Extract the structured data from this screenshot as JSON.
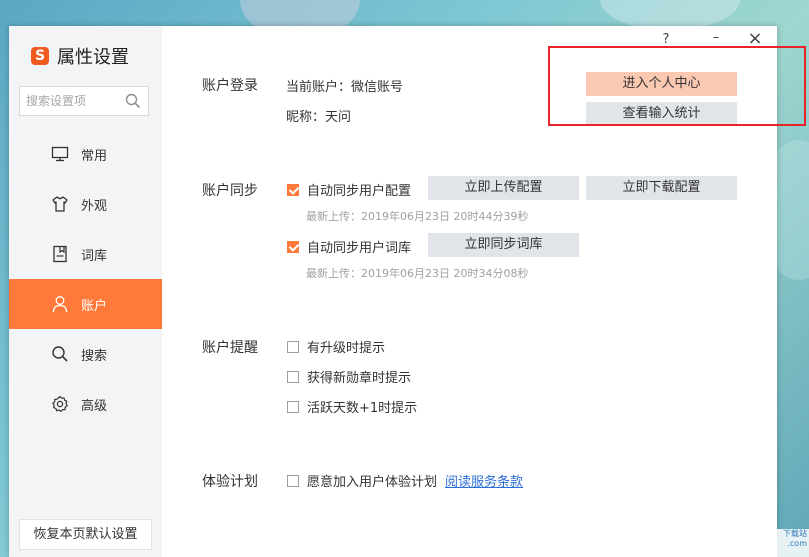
{
  "app": {
    "logo_char": "S",
    "title": "属性设置"
  },
  "window_controls": {
    "help": "?",
    "minimize": "–",
    "close": "×"
  },
  "search": {
    "placeholder": "搜索设置项"
  },
  "sidebar": {
    "items": [
      {
        "label": "常用",
        "icon": "monitor-icon"
      },
      {
        "label": "外观",
        "icon": "shirt-icon"
      },
      {
        "label": "词库",
        "icon": "dictionary-icon"
      },
      {
        "label": "账户",
        "icon": "user-icon",
        "active": true
      },
      {
        "label": "搜索",
        "icon": "search-icon"
      },
      {
        "label": "高级",
        "icon": "gear-icon"
      }
    ],
    "restore_label": "恢复本页默认设置"
  },
  "account_login": {
    "title": "账户登录",
    "current_account": "当前账户：微信账号",
    "nickname": "昵称：天问",
    "enter_center": "进入个人中心",
    "view_stats": "查看输入统计"
  },
  "account_sync": {
    "title": "账户同步",
    "auto_sync_config": {
      "label": "自动同步用户配置",
      "checked": true
    },
    "upload_config": "立即上传配置",
    "download_config": "立即下载配置",
    "last_upload": "最新上传：2019年06月23日 20时44分39秒",
    "auto_sync_dict": {
      "label": "自动同步用户词库",
      "checked": true
    },
    "sync_dict": "立即同步词库",
    "last_upload_dict": "最新上传：2019年06月23日 20时34分08秒"
  },
  "account_reminder": {
    "title": "账户提醒",
    "options": [
      {
        "label": "有升级时提示",
        "checked": false
      },
      {
        "label": "获得新勋章时提示",
        "checked": false
      },
      {
        "label": "活跃天数+1时提示",
        "checked": false
      }
    ]
  },
  "experience_plan": {
    "title": "体验计划",
    "join_label": "愿意加入用户体验计划",
    "join_checked": false,
    "terms_link": "阅读服务条款"
  },
  "colors": {
    "accent": "#ff7a3a",
    "primary_btn": "#fbc8b1",
    "button": "#e1e4e8",
    "highlight": "#e8232a"
  }
}
